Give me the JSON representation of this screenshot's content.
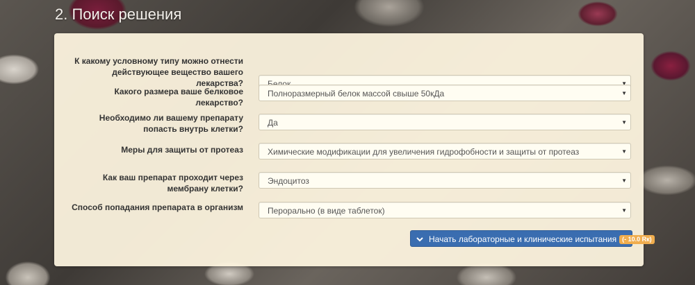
{
  "section": {
    "title": "2. Поиск решения"
  },
  "form": {
    "rows": [
      {
        "question": "К какому условному типу можно отнести действующее вещество вашего лекарства?",
        "value": "Белок"
      },
      {
        "question": "Какого размера ваше белковое лекарство?",
        "value": "Полноразмерный белок массой свыше 50кДа"
      },
      {
        "question": "Необходимо ли вашему препарату попасть внутрь клетки?",
        "value": "Да"
      },
      {
        "question": "Меры для защиты от протеаз",
        "value": "Химические модификации для увеличения гидрофобности и защиты от протеаз"
      },
      {
        "question": "Как ваш препарат проходит через мембрану клетки?",
        "value": "Эндоцитоз"
      },
      {
        "question": "Способ попадания препарата в организм",
        "value": "Перорально (в виде таблеток)"
      }
    ],
    "caret": "▼"
  },
  "action": {
    "label": "Начать лабораторные и клинические испытания",
    "cost": "(- 10.0 Rк)",
    "icon": "chevron-down-icon"
  },
  "colors": {
    "button": "#3a6db0",
    "badge": "#f0ad4e",
    "panel": "#fff6e1"
  }
}
